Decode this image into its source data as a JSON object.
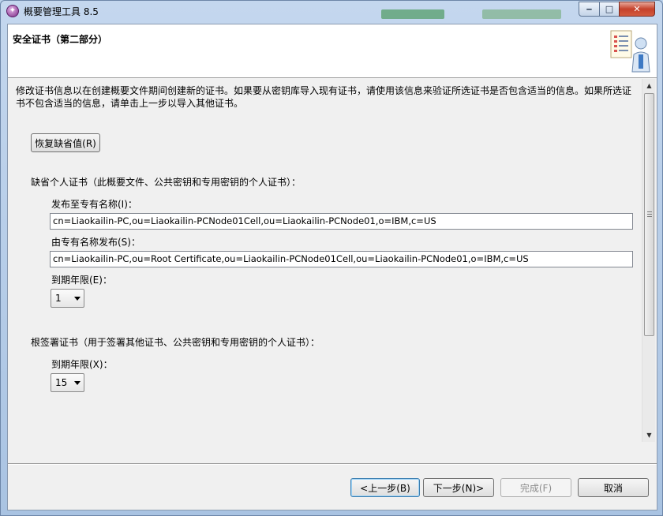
{
  "window": {
    "title": "概要管理工具 8.5",
    "controls": {
      "minimize": "‒",
      "maximize": "□",
      "close": "✕"
    }
  },
  "header": {
    "title": "安全证书（第二部分）"
  },
  "content": {
    "description": "修改证书信息以在创建概要文件期间创建新的证书。如果要从密钥库导入现有证书，请使用该信息来验证所选证书是否包含适当的信息。如果所选证书不包含适当的信息，请单击上一步以导入其他证书。",
    "restore_defaults_button": "恢复缺省值(R)",
    "personal_cert": {
      "section_label": "缺省个人证书（此概要文件、公共密钥和专用密钥的个人证书）：",
      "issued_to_label": "发布至专有名称(I)：",
      "issued_to_value": "cn=Liaokailin-PC,ou=Liaokailin-PCNode01Cell,ou=Liaokailin-PCNode01,o=IBM,c=US",
      "issued_by_label": "由专有名称发布(S)：",
      "issued_by_value": "cn=Liaokailin-PC,ou=Root Certificate,ou=Liaokailin-PCNode01Cell,ou=Liaokailin-PCNode01,o=IBM,c=US",
      "expiration_label": "到期年限(E)：",
      "expiration_value": "1"
    },
    "root_cert": {
      "section_label": "根签署证书（用于签署其他证书、公共密钥和专用密钥的个人证书）：",
      "expiration_label": "到期年限(X)：",
      "expiration_value": "15"
    }
  },
  "footer": {
    "back_button": "<上一步(B)",
    "next_button": "下一步(N)>",
    "finish_button": "完成(F)",
    "cancel_button": "取消"
  }
}
